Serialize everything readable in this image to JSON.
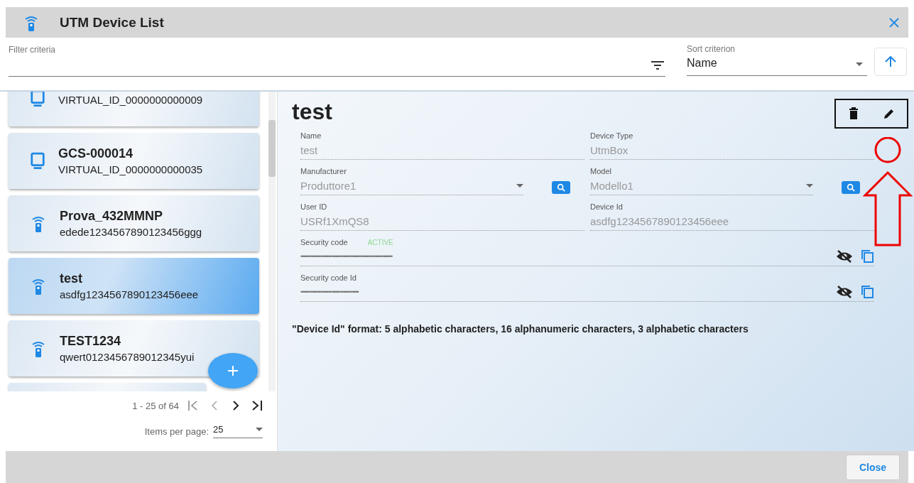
{
  "window": {
    "title": "UTM Device List"
  },
  "filter": {
    "label": "Filter criteria"
  },
  "sort": {
    "label": "Sort criterion",
    "value": "Name"
  },
  "devices": [
    {
      "kind": "monitor",
      "id": "VIRTUAL_ID_0000000000009",
      "selected": false
    },
    {
      "kind": "monitor",
      "name": "GCS-000014",
      "id": "VIRTUAL_ID_0000000000035",
      "selected": false
    },
    {
      "kind": "remote",
      "name": "Prova_432MMNP",
      "id": "edede1234567890123456ggg",
      "selected": false
    },
    {
      "kind": "remote",
      "name": "test",
      "id": "asdfg1234567890123456eee",
      "selected": true
    },
    {
      "kind": "remote",
      "name": "TEST1234",
      "id": "qwert0123456789012345yui",
      "selected": false
    },
    {
      "kind": "empty",
      "selected": false
    }
  ],
  "pagination": {
    "range": "1 - 25 of 64",
    "items_label": "Items per page:",
    "items_value": "25"
  },
  "detail": {
    "title": "test",
    "fields": [
      {
        "kind": "text",
        "label": "Name",
        "value": "test"
      },
      {
        "kind": "text",
        "label": "Device Type",
        "value": "UtmBox"
      },
      {
        "kind": "select",
        "label": "Manufacturer",
        "value": "Produttore1"
      },
      {
        "kind": "select",
        "label": "Model",
        "value": "Modello1"
      },
      {
        "kind": "text",
        "label": "User ID",
        "value": "USRf1XmQS8"
      },
      {
        "kind": "text",
        "label": "Device Id",
        "value": "asdfg1234567890123456eee"
      },
      {
        "kind": "secret",
        "label": "Security code",
        "status": "ACTIVE",
        "value": "••••••••••••••••••••••••••••••••••••••••••••••••••••••••••••"
      },
      {
        "kind": "secret",
        "label": "Security code Id",
        "value": "••••••••••••••••••••••••••••••••••••••"
      }
    ],
    "note": "\"Device Id\" format: 5 alphabetic characters, 16 alphanumeric characters, 3 alphabetic characters"
  },
  "footer": {
    "close": "Close"
  }
}
